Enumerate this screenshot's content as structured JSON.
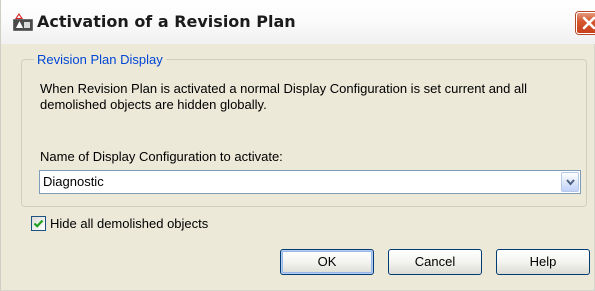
{
  "window": {
    "title": "Activation of a Revision Plan",
    "app_icon": "autocad-icon",
    "close_icon": "close-icon"
  },
  "group": {
    "legend": "Revision Plan Display",
    "description": "When Revision Plan is activated a normal Display Configuration is set current and all demolished objects are hidden globally.",
    "config_label": "Name of Display Configuration to activate:",
    "config_value": "Diagnostic"
  },
  "options": {
    "hide_demolished_label": "Hide all demolished objects",
    "hide_demolished_checked": true
  },
  "buttons": {
    "ok": "OK",
    "cancel": "Cancel",
    "help": "Help"
  },
  "colors": {
    "dialog_bg": "#ece9d8",
    "legend_text": "#0046d5",
    "close_button": "#d4582f"
  }
}
